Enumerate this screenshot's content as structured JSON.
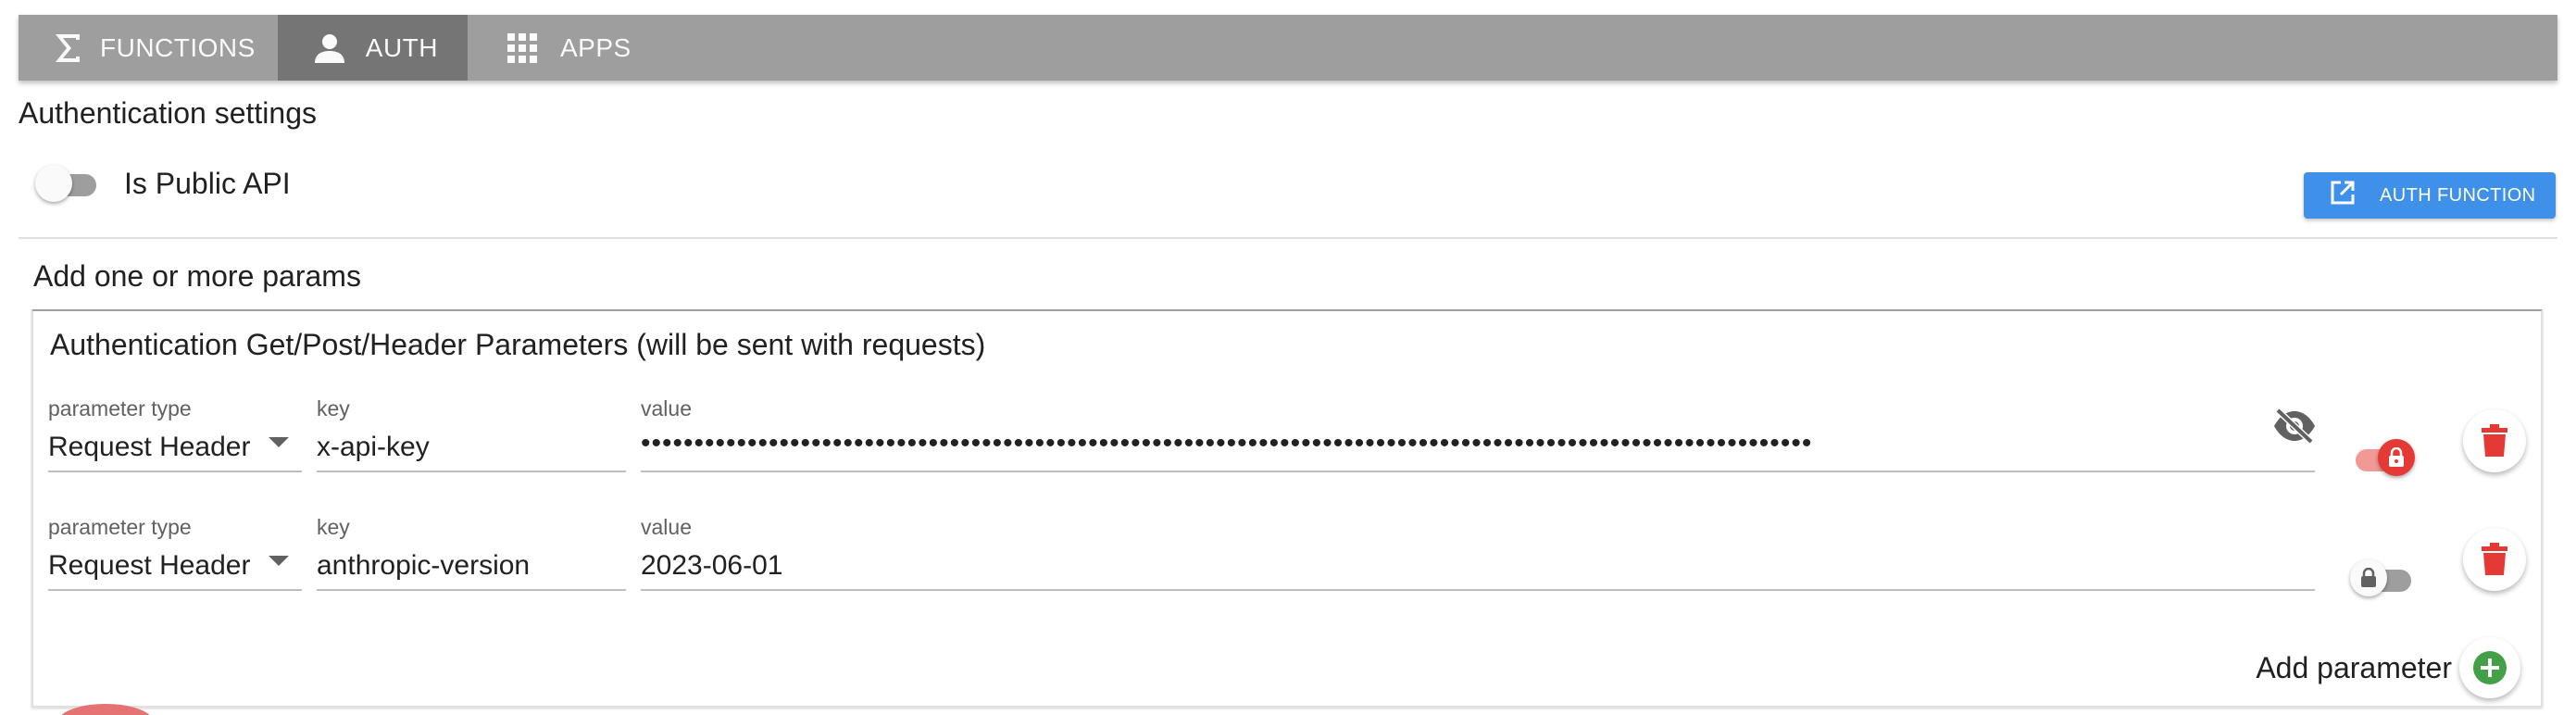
{
  "tabs": [
    {
      "label": "FUNCTIONS",
      "icon": "sigma-icon"
    },
    {
      "label": "AUTH",
      "icon": "person-icon",
      "active": true
    },
    {
      "label": "APPS",
      "icon": "apps-grid-icon"
    }
  ],
  "auth_settings": {
    "title": "Authentication settings",
    "public_api_label": "Is Public API",
    "public_api_enabled": false,
    "auth_function_button": "AUTH FUNCTION"
  },
  "params": {
    "heading": "Add one or more params",
    "card_title": "Authentication Get/Post/Header Parameters (will be sent with requests)",
    "labels": {
      "type": "parameter type",
      "key": "key",
      "value": "value"
    },
    "rows": [
      {
        "type": "Request Header",
        "key": "x-api-key",
        "value": "••••••••••••••••••••••••••••••••••••••••••••••••••••••••••••••••••••••••••••••••••••••••••••••••••••••••••••••",
        "secret": true,
        "visibility_icon": "eye-off-icon"
      },
      {
        "type": "Request Header",
        "key": "anthropic-version",
        "value": "2023-06-01",
        "secret": false
      }
    ],
    "add_label": "Add parameter"
  },
  "colors": {
    "tabbar": "#9e9e9e",
    "tab_active": "#757575",
    "primary": "#3f90e8",
    "danger": "#e53935",
    "success": "#43a047"
  }
}
